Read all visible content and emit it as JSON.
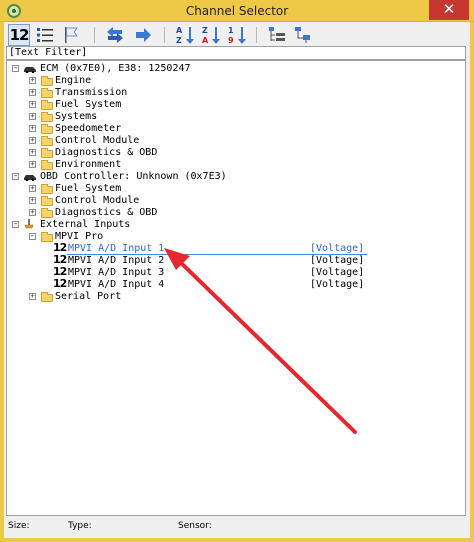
{
  "window": {
    "title": "Channel Selector",
    "close_glyph": "✕"
  },
  "toolbar": {
    "number_view_label": "12",
    "icons": [
      "number-view-icon",
      "list-view-icon",
      "flag-icon",
      "swap-arrows-icon",
      "next-arrow-icon",
      "sort-az-icon",
      "sort-za-icon",
      "sort-19-icon",
      "tree-expand-icon",
      "tree-collapse-icon"
    ],
    "sort_az_top": "A",
    "sort_az_bottom": "Z",
    "sort_za_top": "Z",
    "sort_za_bottom": "A",
    "sort_19_top": "1",
    "sort_19_bottom": "9"
  },
  "filter": {
    "text": "[Text Filter]"
  },
  "tree": {
    "ecm": {
      "label": "ECM (0x7E0), E38: 1250247",
      "children": [
        "Engine",
        "Transmission",
        "Fuel System",
        "Systems",
        "Speedometer",
        "Control Module",
        "Diagnostics & OBD",
        "Environment"
      ]
    },
    "obd": {
      "label": "OBD Controller: Unknown (0x7E3)",
      "children": [
        "Fuel System",
        "Control Module",
        "Diagnostics & OBD"
      ]
    },
    "external": {
      "label": "External Inputs",
      "mpvi": {
        "label": "MPVI Pro",
        "channels": [
          {
            "num": "12",
            "label": "MPVI A/D Input 1",
            "unit": "[Voltage]"
          },
          {
            "num": "12",
            "label": "MPVI A/D Input 2",
            "unit": "[Voltage]"
          },
          {
            "num": "12",
            "label": "MPVI A/D Input 3",
            "unit": "[Voltage]"
          },
          {
            "num": "12",
            "label": "MPVI A/D Input 4",
            "unit": "[Voltage]"
          }
        ]
      },
      "serial": "Serial Port"
    }
  },
  "status": {
    "size_label": "Size:",
    "type_label": "Type:",
    "sensor_label": "Sensor:"
  },
  "colors": {
    "titlebar": "#f0c847",
    "close": "#c7372f",
    "selection": "#2f69c8",
    "annotation_arrow": "#e5272e"
  }
}
